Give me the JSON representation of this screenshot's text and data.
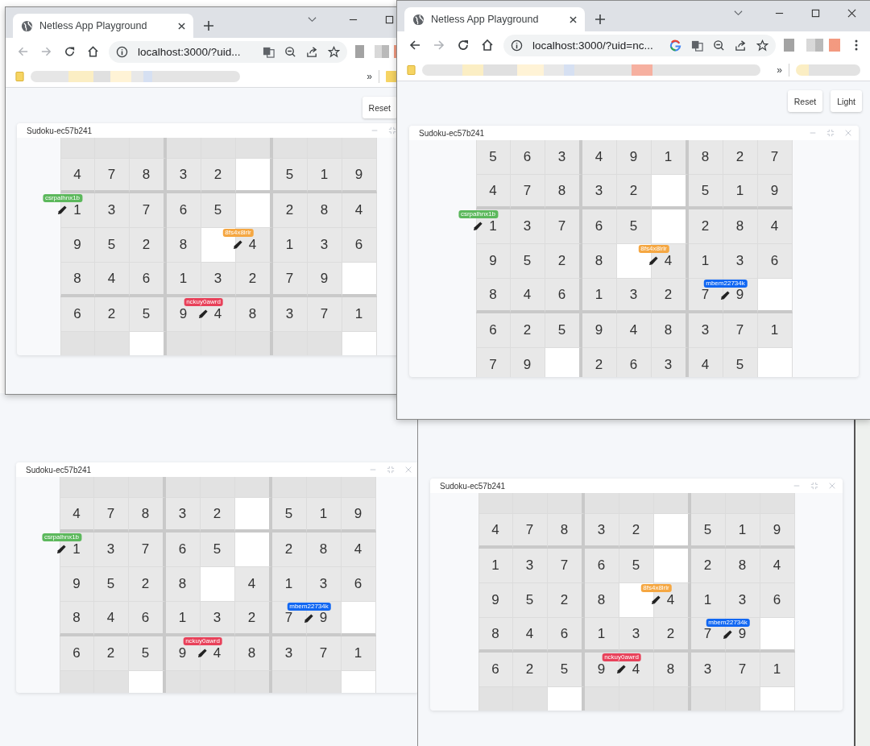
{
  "windows": [
    {
      "kind": "browser",
      "tab": {
        "title": "Netless App Playground"
      },
      "address": "localhost:3000/?uid...",
      "buttons": [
        "Reset"
      ],
      "bookmarks_more": "»",
      "panel": {
        "title": "Sudoku-ec57b241",
        "cut_top_filled": [
          true,
          true,
          true,
          true,
          true,
          true,
          true,
          true,
          true
        ],
        "rows": [
          [
            "4",
            "7",
            "8",
            "3",
            "2",
            null,
            "5",
            "1",
            "9"
          ],
          [
            {
              "value": "1",
              "cursor": {
                "name": "csrpalhnx1b",
                "color": "#5cb85c"
              }
            },
            "3",
            "7",
            "6",
            "5",
            null,
            "2",
            "8",
            "4"
          ],
          [
            "9",
            "5",
            "2",
            "8",
            null,
            {
              "value": "4",
              "cursor": {
                "name": "8fs4x8lrlr",
                "color": "#f5a742"
              }
            },
            "1",
            "3",
            "6"
          ],
          [
            "8",
            "4",
            "6",
            "1",
            "3",
            "2",
            "7",
            "9",
            null
          ],
          [
            "6",
            "2",
            "5",
            "9",
            {
              "value": "4",
              "cursor": {
                "name": "nckuy0awrd",
                "color": "#e8415a"
              }
            },
            "8",
            "3",
            "7",
            "1"
          ]
        ],
        "cut_bottom_filled": [
          true,
          true,
          false,
          true,
          true,
          true,
          true,
          true,
          false
        ]
      }
    },
    {
      "kind": "browser",
      "tab": {
        "title": "Netless App Playground"
      },
      "address": "localhost:3000/?uid=nc...",
      "buttons": [
        "Reset",
        "Light"
      ],
      "bookmarks_more": "»",
      "panel": {
        "title": "Sudoku-ec57b241",
        "rows": [
          [
            "5",
            "6",
            "3",
            "4",
            "9",
            "1",
            "8",
            "2",
            "7"
          ],
          [
            "4",
            "7",
            "8",
            "3",
            "2",
            null,
            "5",
            "1",
            "9"
          ],
          [
            {
              "value": "1",
              "cursor": {
                "name": "csrpalhnx1b",
                "color": "#5cb85c"
              }
            },
            "3",
            "7",
            "6",
            "5",
            null,
            "2",
            "8",
            "4"
          ],
          [
            "9",
            "5",
            "2",
            "8",
            null,
            {
              "value": "4",
              "cursor": {
                "name": "8fs4x8lrlr",
                "color": "#f5a742"
              }
            },
            "1",
            "3",
            "6"
          ],
          [
            "8",
            "4",
            "6",
            "1",
            "3",
            "2",
            "7",
            {
              "value": "9",
              "cursor": {
                "name": "mbem22734k",
                "color": "#1167f2"
              }
            },
            null
          ],
          [
            "6",
            "2",
            "5",
            "9",
            "4",
            "8",
            "3",
            "7",
            "1"
          ],
          [
            "7",
            "9",
            null,
            "2",
            "6",
            "3",
            "4",
            "5",
            null
          ]
        ]
      }
    },
    {
      "kind": "page",
      "panel": {
        "title": "Sudoku-ec57b241",
        "cut_top_filled": [
          true,
          true,
          true,
          true,
          true,
          true,
          true,
          true,
          true
        ],
        "rows": [
          [
            "4",
            "7",
            "8",
            "3",
            "2",
            null,
            "5",
            "1",
            "9"
          ],
          [
            {
              "value": "1",
              "cursor": {
                "name": "csrpalhnx1b",
                "color": "#5cb85c"
              }
            },
            "3",
            "7",
            "6",
            "5",
            null,
            "2",
            "8",
            "4"
          ],
          [
            "9",
            "5",
            "2",
            "8",
            null,
            "4",
            "1",
            "3",
            "6"
          ],
          [
            "8",
            "4",
            "6",
            "1",
            "3",
            "2",
            "7",
            {
              "value": "9",
              "cursor": {
                "name": "mbem22734k",
                "color": "#1167f2"
              }
            },
            null
          ],
          [
            "6",
            "2",
            "5",
            "9",
            {
              "value": "4",
              "cursor": {
                "name": "nckuy0awrd",
                "color": "#e8415a"
              }
            },
            "8",
            "3",
            "7",
            "1"
          ]
        ],
        "cut_bottom_filled": [
          true,
          true,
          false,
          true,
          true,
          true,
          true,
          true,
          false
        ]
      }
    },
    {
      "kind": "page",
      "panel": {
        "title": "Sudoku-ec57b241",
        "cut_top_filled": [
          true,
          true,
          true,
          true,
          true,
          true,
          true,
          true,
          true
        ],
        "rows": [
          [
            "4",
            "7",
            "8",
            "3",
            "2",
            null,
            "5",
            "1",
            "9"
          ],
          [
            "1",
            "3",
            "7",
            "6",
            "5",
            null,
            "2",
            "8",
            "4"
          ],
          [
            "9",
            "5",
            "2",
            "8",
            null,
            {
              "value": "4",
              "cursor": {
                "name": "8fs4x8lrlr",
                "color": "#f5a742"
              }
            },
            "1",
            "3",
            "6"
          ],
          [
            "8",
            "4",
            "6",
            "1",
            "3",
            "2",
            "7",
            {
              "value": "9",
              "cursor": {
                "name": "mbem22734k",
                "color": "#1167f2"
              }
            },
            null
          ],
          [
            "6",
            "2",
            "5",
            "9",
            {
              "value": "4",
              "cursor": {
                "name": "nckuy0awrd",
                "color": "#e8415a"
              }
            },
            "8",
            "3",
            "7",
            "1"
          ]
        ],
        "cut_bottom_filled": [
          true,
          true,
          false,
          true,
          true,
          true,
          true,
          true,
          false
        ]
      }
    }
  ]
}
